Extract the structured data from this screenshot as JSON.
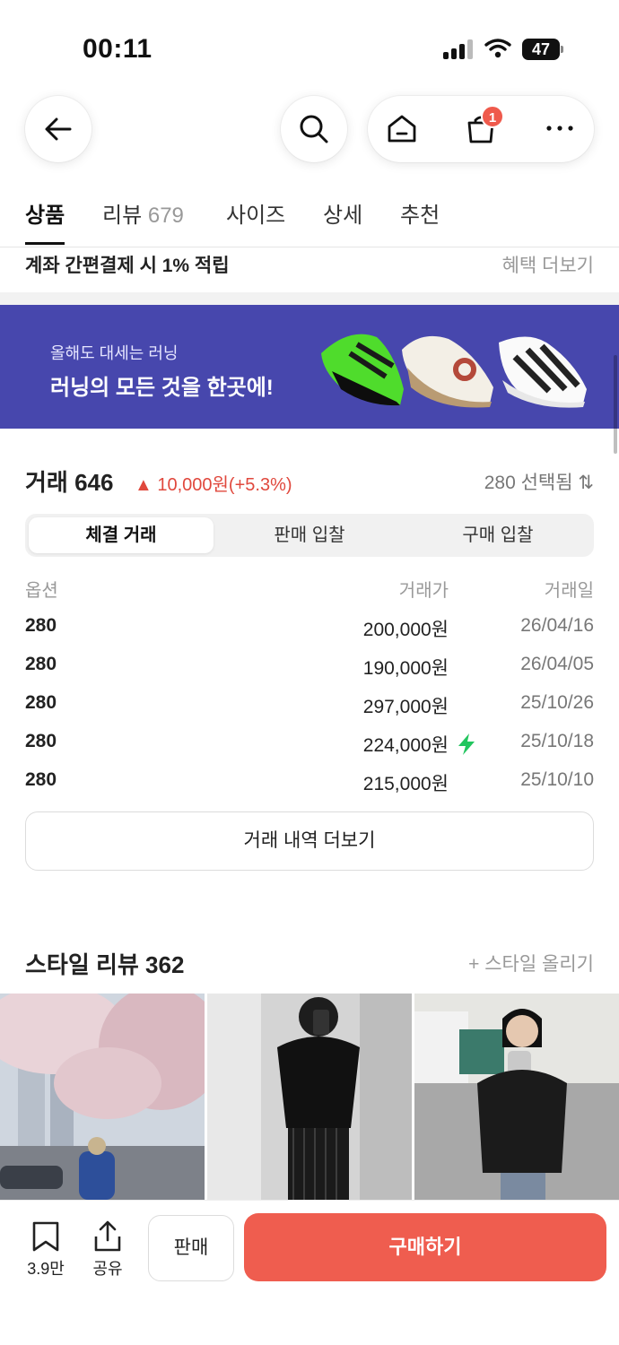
{
  "status_bar": {
    "time": "00:11",
    "battery": "47"
  },
  "header": {
    "cart_badge": "1"
  },
  "tabs": [
    {
      "label": "상품",
      "count": ""
    },
    {
      "label": "리뷰",
      "count": "679"
    },
    {
      "label": "사이즈",
      "count": ""
    },
    {
      "label": "상세",
      "count": ""
    },
    {
      "label": "추천",
      "count": ""
    }
  ],
  "benefit": {
    "text": "계좌 간편결제 시 1% 적립",
    "more": "혜택 더보기"
  },
  "banner": {
    "subtitle": "올해도 대세는 러닝",
    "title": "러닝의 모든 것을 한곳에!"
  },
  "trades": {
    "title": "거래 646",
    "change": "▲ 10,000원(+5.3%)",
    "size_selected": "280 선택됨 ⇅",
    "segments": [
      "체결 거래",
      "판매 입찰",
      "구매 입찰"
    ],
    "columns": {
      "option": "옵션",
      "price": "거래가",
      "date": "거래일"
    },
    "rows": [
      {
        "option": "280",
        "price": "200,000원",
        "date": "26/04/16",
        "fast": false
      },
      {
        "option": "280",
        "price": "190,000원",
        "date": "26/04/05",
        "fast": false
      },
      {
        "option": "280",
        "price": "297,000원",
        "date": "25/10/26",
        "fast": false
      },
      {
        "option": "280",
        "price": "224,000원",
        "date": "25/10/18",
        "fast": true
      },
      {
        "option": "280",
        "price": "215,000원",
        "date": "25/10/10",
        "fast": false
      }
    ],
    "more_label": "거래 내역 더보기"
  },
  "style_review": {
    "title": "스타일 리뷰 362",
    "upload": "+ 스타일 올리기"
  },
  "bottom_bar": {
    "bookmark_count": "3.9만",
    "share_label": "공유",
    "sell_label": "판매",
    "buy_label": "구매하기"
  },
  "colors": {
    "accent": "#ef5d4f",
    "banner_bg": "#4747ad",
    "price_up": "#e0483d",
    "fast_bolt": "#22c55e"
  }
}
